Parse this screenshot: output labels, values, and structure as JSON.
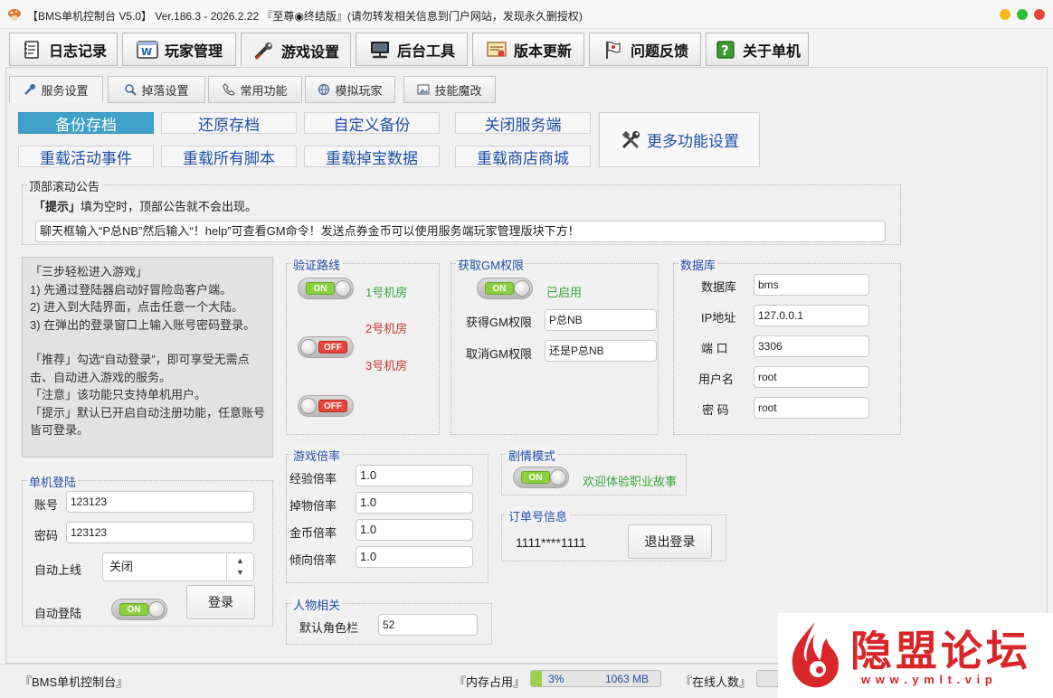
{
  "window": {
    "title": "【BMS单机控制台 V5.0】 Ver.186.3 - 2026.2.22 『至尊◉终结版』(请勿转发相关信息到门户网站，发现永久删授权)",
    "controls": {
      "min_color": "#f5b71a",
      "max_color": "#2fbe3a",
      "close_color": "#e8453c"
    }
  },
  "main_tabs": [
    {
      "label": "日志记录",
      "icon": "notebook-icon"
    },
    {
      "label": "玩家管理",
      "icon": "browser-icon"
    },
    {
      "label": "游戏设置",
      "icon": "wrench-icon",
      "active": true
    },
    {
      "label": "后台工具",
      "icon": "monitor-icon"
    },
    {
      "label": "版本更新",
      "icon": "certificate-icon"
    },
    {
      "label": "问题反馈",
      "icon": "flag-icon"
    },
    {
      "label": "关于单机",
      "icon": "help-book-icon"
    }
  ],
  "sub_tabs": [
    {
      "label": "服务设置",
      "active": true
    },
    {
      "label": "掉落设置"
    },
    {
      "label": "常用功能"
    },
    {
      "label": "模拟玩家"
    },
    {
      "label": "技能魔改"
    }
  ],
  "actions": {
    "row1": [
      "备份存档",
      "还原存档",
      "自定义备份",
      "关闭服务端"
    ],
    "row2": [
      "重载活动事件",
      "重载所有脚本",
      "重载掉宝数据",
      "重载商店商城"
    ],
    "more": "更多功能设置"
  },
  "announcement": {
    "title": "顶部滚动公告",
    "hint_tag": "「提示」",
    "hint_text": "填为空时，顶部公告就不会出现。",
    "value": "聊天框输入“P总NB”然后输入“！help”可查看GM命令！发送点券金币可以使用服务端玩家管理版块下方！"
  },
  "guide": {
    "heading": "「三步轻松进入游戏」",
    "lines": [
      "1) 先通过登陆器启动好冒险岛客户端。",
      "2) 进入到大陆界面，点击任意一个大陆。",
      "3) 在弹出的登录窗口上输入账号密码登录。"
    ],
    "tip1": "「推荐」勾选“自动登录”，即可享受无需点击、自动进入游戏的服务。",
    "tip2": "「注意」该功能只支持单机用户。",
    "tip3": "「提示」默认已开启自动注册功能，任意账号皆可登录。"
  },
  "login": {
    "title": "单机登陆",
    "account_label": "账号",
    "account_value": "123123",
    "password_label": "密码",
    "password_value": "123123",
    "auto_online_label": "自动上线",
    "auto_online_value": "关闭",
    "auto_login_label": "自动登陆",
    "auto_login_state": "ON",
    "login_button": "登录"
  },
  "route": {
    "title": "验证路线",
    "items": [
      {
        "state": "ON",
        "label": "1号机房",
        "color": "#3aa53a"
      },
      {
        "state": "OFF",
        "label": "2号机房",
        "color": "#c0392b"
      },
      {
        "state": "OFF",
        "label": "3号机房",
        "color": "#c0392b"
      }
    ]
  },
  "gm": {
    "title": "获取GM权限",
    "state": "ON",
    "status": "已启用",
    "get_label": "获得GM权限",
    "get_value": "P总NB",
    "cancel_label": "取消GM权限",
    "cancel_value": "还是P总NB"
  },
  "database": {
    "title": "数据库",
    "fields": [
      {
        "label": "数据库",
        "value": "bms"
      },
      {
        "label": "IP地址",
        "value": "127.0.0.1"
      },
      {
        "label": "端 口",
        "value": "3306"
      },
      {
        "label": "用户名",
        "value": "root"
      },
      {
        "label": "密 码",
        "value": "root"
      }
    ]
  },
  "rates": {
    "title": "游戏倍率",
    "fields": [
      {
        "label": "经验倍率",
        "value": "1.0"
      },
      {
        "label": "掉物倍率",
        "value": "1.0"
      },
      {
        "label": "金币倍率",
        "value": "1.0"
      },
      {
        "label": "倾向倍率",
        "value": "1.0"
      }
    ]
  },
  "story": {
    "title": "剧情模式",
    "state": "ON",
    "text": "欢迎体验职业故事"
  },
  "order": {
    "title": "订单号信息",
    "number": "1111****1111",
    "logout_button": "退出登录"
  },
  "character": {
    "title": "人物相关",
    "slot_label": "默认角色栏",
    "slot_value": "52"
  },
  "status_bar": {
    "app": "『BMS单机控制台』",
    "mem_label": "『内存占用』",
    "mem_percent": "3%",
    "mem_fraction": 0.03,
    "mem_value": "1063 MB",
    "online_label": "『在线人数』"
  },
  "watermark": {
    "text": "隐盟论坛",
    "url": "w w w . y m l t . v i p",
    "color": "#d9262a"
  }
}
